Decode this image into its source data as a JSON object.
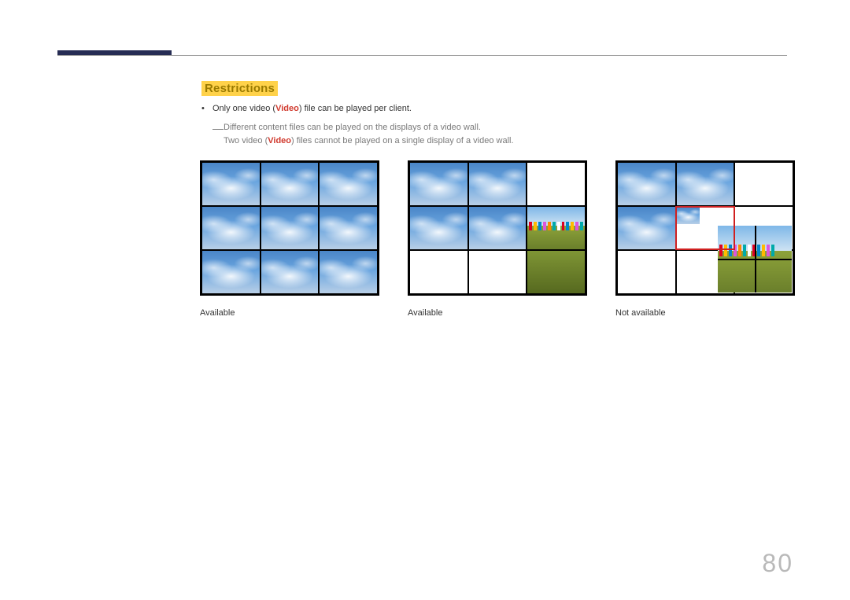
{
  "section": {
    "title": "Restrictions"
  },
  "bullets": {
    "line1_pre": "Only one video (",
    "line1_video": "Video",
    "line1_post": ") file can be played per client.",
    "sub1": "Different content files can be played on the displays of a video wall.",
    "sub2_pre": "Two video (",
    "sub2_video": "Video",
    "sub2_post": ") files cannot be played on a single display of a video wall."
  },
  "figures": {
    "fig1": {
      "caption": "Available"
    },
    "fig2": {
      "caption": "Available"
    },
    "fig3": {
      "caption": "Not available"
    }
  },
  "page_number": "80"
}
